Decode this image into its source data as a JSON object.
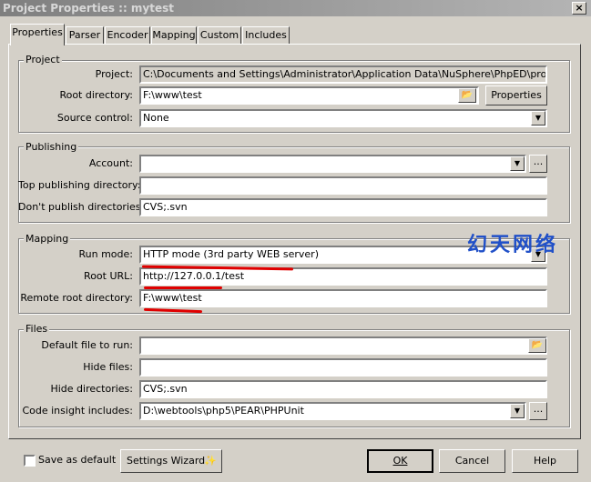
{
  "window": {
    "title": "Project Properties :: mytest",
    "close_glyph": "×"
  },
  "tabs": [
    "Properties",
    "Parser",
    "Encoder",
    "Mapping",
    "Custom",
    "Includes"
  ],
  "project": {
    "legend": "Project",
    "project_label": "Project:",
    "project_value": "C:\\Documents and Settings\\Administrator\\Application Data\\NuSphere\\PhpED\\projects\\mytest",
    "root_label": "Root directory:",
    "root_value": "F:\\www\\test",
    "properties_button": "Properties",
    "source_label": "Source control:",
    "source_value": "None"
  },
  "publishing": {
    "legend": "Publishing",
    "account_label": "Account:",
    "account_value": "",
    "top_label": "Top publishing directory:",
    "top_value": "",
    "dont_label": "Don't publish directories:",
    "dont_value": "CVS;.svn"
  },
  "mapping": {
    "legend": "Mapping",
    "run_label": "Run mode:",
    "run_value": "HTTP mode (3rd party WEB server)",
    "url_label": "Root URL:",
    "url_value": "http://127.0.0.1/test",
    "remote_label": "Remote root directory:",
    "remote_value": "F:\\www\\test"
  },
  "files": {
    "legend": "Files",
    "default_label": "Default file to run:",
    "default_value": "",
    "hide_files_label": "Hide files:",
    "hide_files_value": "",
    "hide_dirs_label": "Hide directories:",
    "hide_dirs_value": "CVS;.svn",
    "insight_label": "Code insight includes:",
    "insight_value": "D:\\webtools\\php5\\PEAR\\PHPUnit"
  },
  "watermark": "幻天网络",
  "footer": {
    "save_default_label": "Save as default",
    "wizard_label": "Settings Wizard",
    "ok": "OK",
    "cancel": "Cancel",
    "help": "Help"
  },
  "glyphs": {
    "dropdown": "▼",
    "ellipsis": "...",
    "folder": "📂",
    "wand": "✨"
  },
  "colors": {
    "annotation_red": "#e00000",
    "watermark_blue": "#2050c8"
  }
}
